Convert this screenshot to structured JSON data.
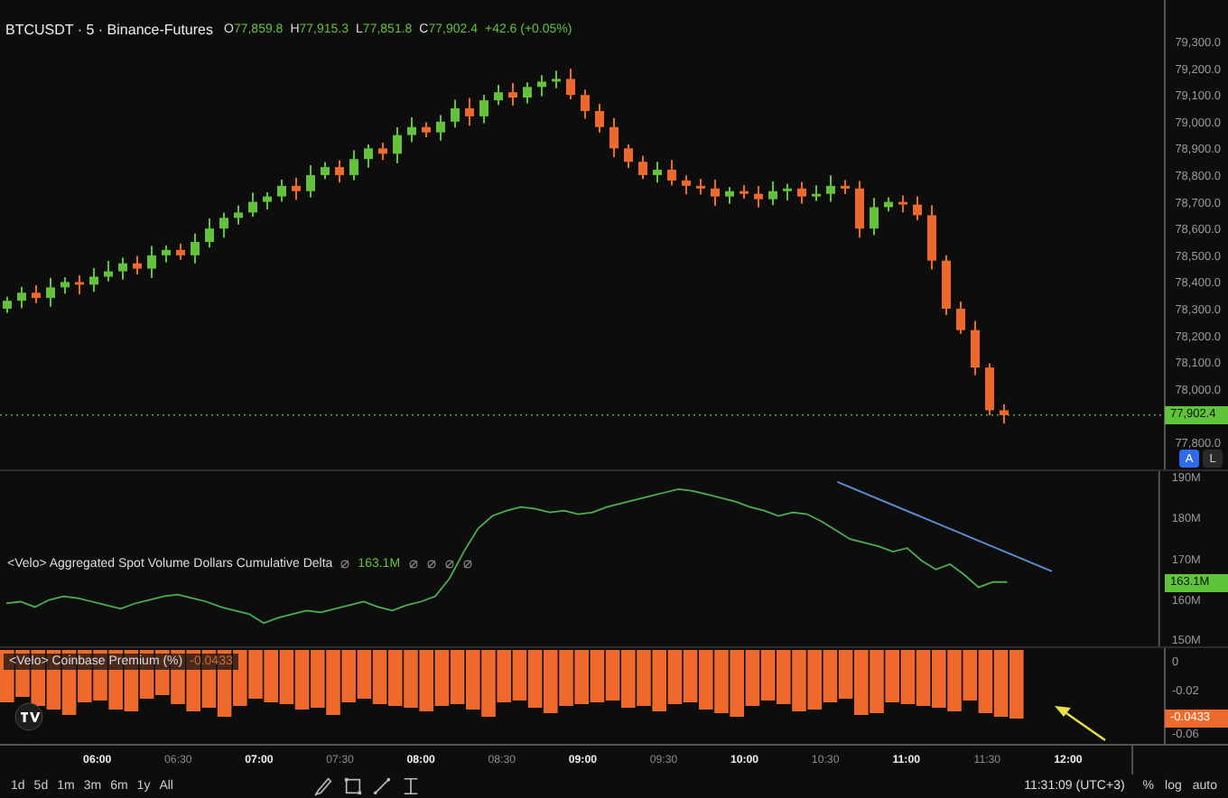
{
  "header": {
    "symbol": "BTCUSDT · 5 · Binance-Futures",
    "ohlc": [
      {
        "label": "O",
        "value": "77,859.8"
      },
      {
        "label": "H",
        "value": "77,915.3"
      },
      {
        "label": "L",
        "value": "77,851.8"
      },
      {
        "label": "C",
        "value": "77,902.4"
      }
    ],
    "change": "+42.6 (+0.05%)"
  },
  "price_pane": {
    "axis": [
      "79,300.0",
      "79,200.0",
      "79,100.0",
      "79,000.0",
      "78,900.0",
      "78,800.0",
      "78,700.0",
      "78,600.0",
      "78,500.0",
      "78,400.0",
      "78,300.0",
      "78,200.0",
      "78,100.0",
      "78,000.0",
      "77,800.0"
    ],
    "last_price": "77,902.4",
    "scale_buttons": [
      {
        "label": "A",
        "selected": true
      },
      {
        "label": "L",
        "selected": false
      }
    ]
  },
  "cvd_pane": {
    "title": "<Velo> Aggregated Spot Volume Dollars Cumulative Delta",
    "value": "163.1M",
    "axis": [
      "190M",
      "180M",
      "170M",
      "160M",
      "150M"
    ],
    "last_value": "163.1M"
  },
  "premium_pane": {
    "title": "<Velo> Coinbase Premium (%)",
    "value": "-0.0433",
    "axis": [
      "0",
      "-0.02",
      "-0.06"
    ],
    "last_value": "-0.0433"
  },
  "time_axis": [
    {
      "label": "06:00",
      "major": true
    },
    {
      "label": "06:30",
      "major": false
    },
    {
      "label": "07:00",
      "major": true
    },
    {
      "label": "07:30",
      "major": false
    },
    {
      "label": "08:00",
      "major": true
    },
    {
      "label": "08:30",
      "major": false
    },
    {
      "label": "09:00",
      "major": true
    },
    {
      "label": "09:30",
      "major": false
    },
    {
      "label": "10:00",
      "major": true
    },
    {
      "label": "10:30",
      "major": false
    },
    {
      "label": "11:00",
      "major": true
    },
    {
      "label": "11:30",
      "major": false
    },
    {
      "label": "12:00",
      "major": true
    }
  ],
  "ranges": [
    "1d",
    "5d",
    "1m",
    "3m",
    "6m",
    "1y",
    "All"
  ],
  "clock": "11:31:09 (UTC+3)",
  "scale_options": [
    "%",
    "log",
    "auto"
  ]
}
